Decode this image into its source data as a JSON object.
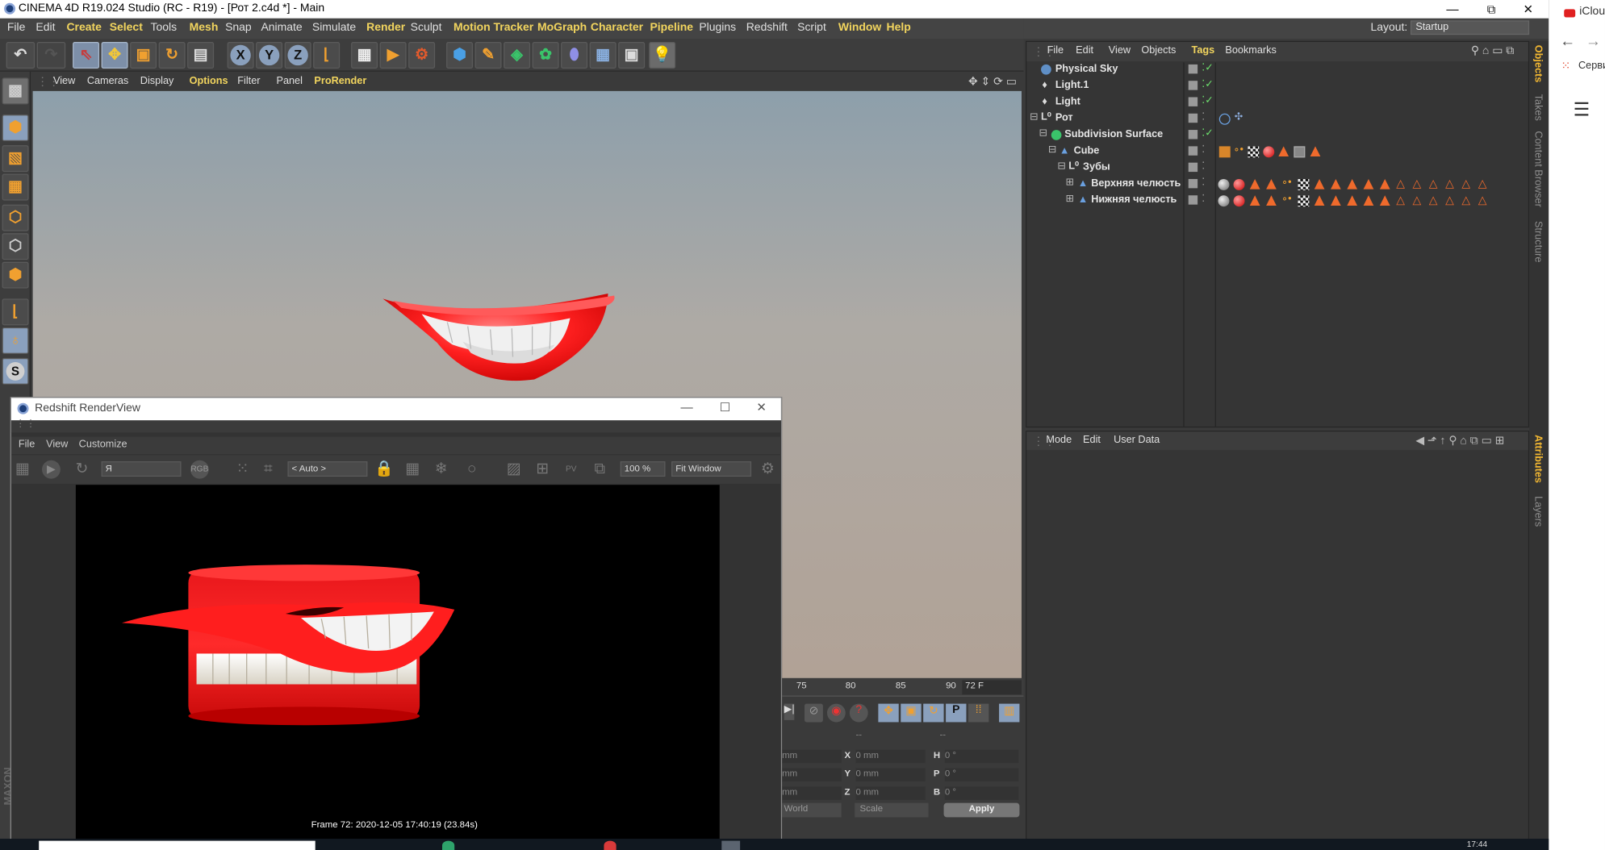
{
  "window": {
    "title": "CINEMA 4D R19.024 Studio (RC - R19) - [Рот 2.c4d *] - Main",
    "minimize": "—",
    "maximize": "⧉",
    "close": "✕"
  },
  "menu": [
    "File",
    "Edit",
    "Create",
    "Select",
    "Tools",
    "Mesh",
    "Snap",
    "Animate",
    "Simulate",
    "Render",
    "Sculpt",
    "Motion Tracker",
    "MoGraph",
    "Character",
    "Pipeline",
    "Plugins",
    "Redshift",
    "Script",
    "Window",
    "Help"
  ],
  "layout": {
    "label": "Layout:",
    "value": "Startup"
  },
  "viewport_menu": [
    "View",
    "Cameras",
    "Display",
    "Options",
    "Filter",
    "Panel",
    "ProRender"
  ],
  "object_manager": {
    "menu": [
      "File",
      "Edit",
      "View",
      "Objects",
      "Tags",
      "Bookmarks"
    ],
    "objects": [
      {
        "name": "Physical Sky"
      },
      {
        "name": "Light.1"
      },
      {
        "name": "Light"
      },
      {
        "name": "Рот"
      },
      {
        "name": "Subdivision Surface"
      },
      {
        "name": "Cube"
      },
      {
        "name": "Зубы"
      },
      {
        "name": "Верхняя челюсть"
      },
      {
        "name": "Нижняя челюсть"
      }
    ]
  },
  "attributes": {
    "menu": [
      "Mode",
      "Edit",
      "User Data"
    ]
  },
  "side_tabs": [
    "Objects",
    "Takes",
    "Content Browser",
    "Structure",
    "Attributes",
    "Layers"
  ],
  "timeline": {
    "ticks": [
      "75",
      "80",
      "85",
      "90"
    ],
    "frame": "72 F",
    "coords": {
      "x": "0 mm",
      "y": "0 mm",
      "z": "0 mm",
      "h": "0 °",
      "p": "0 °",
      "b": "0 °",
      "mm": "mm"
    },
    "world": "World",
    "scale": "Scale",
    "apply": "Apply",
    "dash": "--"
  },
  "redshift": {
    "title": "Redshift RenderView",
    "menu": [
      "File",
      "View",
      "Customize"
    ],
    "aov": "Я",
    "camera": "< Auto >",
    "zoom": "100 %",
    "fit": "Fit Window",
    "status": "Frame  72:  2020-12-05  17:40:19  (23.84s)"
  },
  "browser": {
    "tab": "iClou",
    "bookmark": "Серви"
  },
  "taskbar": {
    "time": "17:44"
  },
  "brand": "MAXON",
  "colors": {
    "accent": "#f2d55e",
    "tag_orange": "#ef6a2c",
    "lips_red": "#e8171b"
  }
}
